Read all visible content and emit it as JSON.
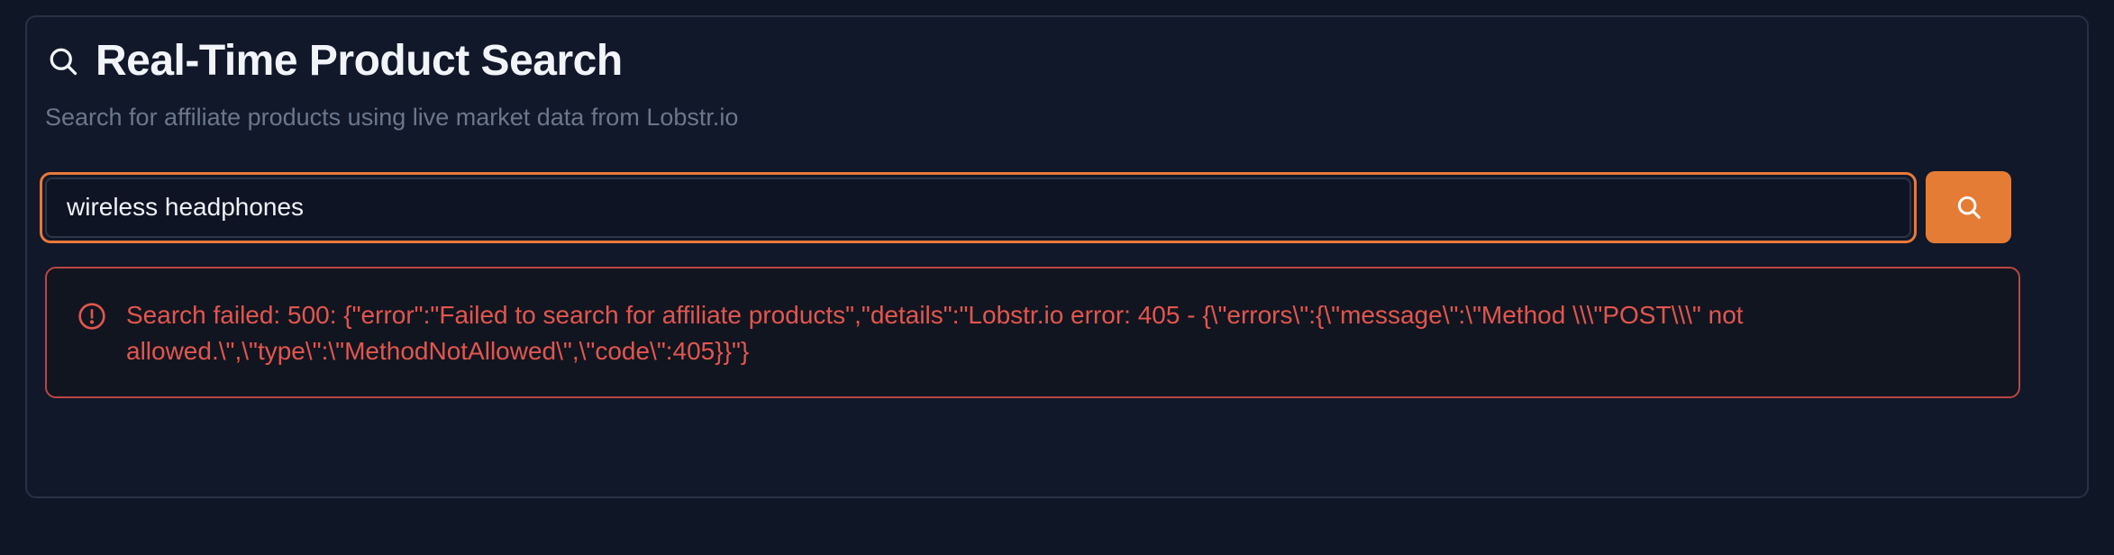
{
  "header": {
    "title": "Real-Time Product Search",
    "subtitle": "Search for affiliate products using live market data from Lobstr.io",
    "icon": "search-icon"
  },
  "search": {
    "value": "wireless headphones",
    "button_icon": "search-icon"
  },
  "error": {
    "icon": "alert-circle-icon",
    "message": "Search failed: 500: {\"error\":\"Failed to search for affiliate products\",\"details\":\"Lobstr.io error: 405 - {\\\"errors\\\":{\\\"message\\\":\\\"Method \\\\\\\"POST\\\\\\\" not allowed.\\\",\\\"type\\\":\\\"MethodNotAllowed\\\",\\\"code\\\":405}}\"}"
  },
  "colors": {
    "background": "#0f1626",
    "card": "#111829",
    "accent": "#e57c35",
    "error": "#e2564f",
    "title": "#f1f4f9",
    "subtitle": "#6b778c"
  }
}
